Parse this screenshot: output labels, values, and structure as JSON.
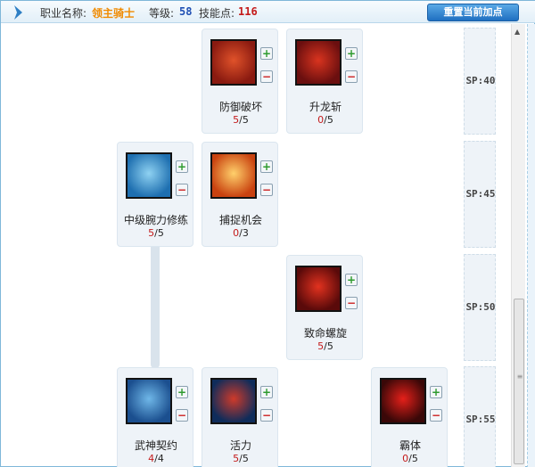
{
  "header": {
    "job_label": "职业名称:",
    "job_value": "领主骑士",
    "level_label": "等级:",
    "level_value": "58",
    "sp_label": "技能点:",
    "sp_value": "116",
    "reset_button": "重置当前加点"
  },
  "skills": [
    {
      "name": "防御破坏",
      "current": "5",
      "max": "5",
      "icon": "defense-break-icon",
      "colors": [
        "#8a1a10",
        "#e0522a"
      ]
    },
    {
      "name": "升龙斩",
      "current": "0",
      "max": "5",
      "icon": "rising-dragon-slash-icon",
      "colors": [
        "#6b0f0f",
        "#d9341f"
      ]
    },
    {
      "name": "中级腕力修练",
      "current": "5",
      "max": "5",
      "icon": "strength-training-icon",
      "colors": [
        "#1e6fb0",
        "#8fd2f2"
      ]
    },
    {
      "name": "捕捉机会",
      "current": "0",
      "max": "3",
      "icon": "seize-opportunity-icon",
      "colors": [
        "#c9420f",
        "#ffd06b"
      ]
    },
    {
      "name": "致命螺旋",
      "current": "5",
      "max": "5",
      "icon": "deadly-spiral-icon",
      "colors": [
        "#5a0a0a",
        "#e2321f"
      ]
    },
    {
      "name": "武神契约",
      "current": "4",
      "max": "4",
      "icon": "war-god-pact-icon",
      "colors": [
        "#1b4f8f",
        "#6fb7e8"
      ]
    },
    {
      "name": "活力",
      "current": "5",
      "max": "5",
      "icon": "vitality-icon",
      "colors": [
        "#0f2c5a",
        "#cf3a2a"
      ]
    },
    {
      "name": "霸体",
      "current": "0",
      "max": "5",
      "icon": "super-armor-icon",
      "colors": [
        "#3a0808",
        "#e5201a"
      ]
    }
  ],
  "sp_rows": [
    "SP:40",
    "SP:45",
    "SP:50",
    "SP:55"
  ],
  "buttons": {
    "plus": "+",
    "minus": "−"
  }
}
